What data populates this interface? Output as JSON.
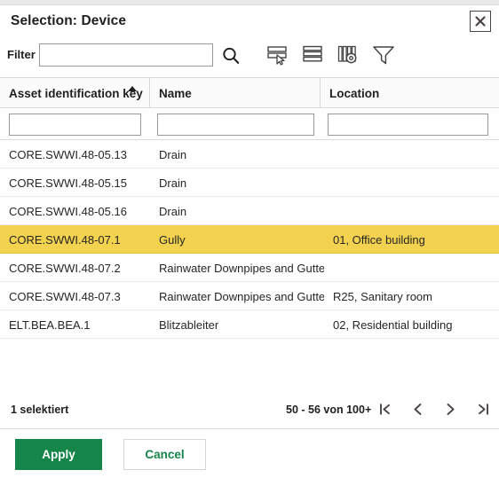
{
  "dialog": {
    "title": "Selection: Device",
    "close_label": "×"
  },
  "filter": {
    "label": "Filter",
    "value": "",
    "placeholder": "",
    "search_icon": "search-icon"
  },
  "toolbar": {
    "icons": [
      {
        "name": "select-rows-icon",
        "title": "Select rows"
      },
      {
        "name": "rows-icon",
        "title": "Rows"
      },
      {
        "name": "columns-settings-icon",
        "title": "Column settings"
      },
      {
        "name": "funnel-filter-icon",
        "title": "Filter"
      }
    ]
  },
  "table": {
    "columns": [
      {
        "label": "Asset identification key",
        "sorted": "asc",
        "filter_value": ""
      },
      {
        "label": "Name",
        "sorted": "",
        "filter_value": ""
      },
      {
        "label": "Location",
        "sorted": "",
        "filter_value": ""
      }
    ],
    "rows": [
      {
        "key": "CORE.SWWI.48-05.13",
        "name": "Drain",
        "location": "",
        "selected": false
      },
      {
        "key": "CORE.SWWI.48-05.15",
        "name": "Drain",
        "location": "",
        "selected": false
      },
      {
        "key": "CORE.SWWI.48-05.16",
        "name": "Drain",
        "location": "",
        "selected": false
      },
      {
        "key": "CORE.SWWI.48-07.1",
        "name": "Gully",
        "location": "01, Office building",
        "selected": true
      },
      {
        "key": "CORE.SWWI.48-07.2",
        "name": "Rainwater Downpipes and Gutters",
        "location": "",
        "selected": false
      },
      {
        "key": "CORE.SWWI.48-07.3",
        "name": "Rainwater Downpipes and Gutters",
        "location": "R25, Sanitary room",
        "selected": false
      },
      {
        "key": "ELT.BEA.BEA.1",
        "name": "Blitzableiter",
        "location": "02, Residential building",
        "selected": false
      }
    ]
  },
  "status": {
    "selected_count": "1 selektiert",
    "page_range": "50 - 56 von 100+",
    "pager": [
      {
        "name": "first-page-icon",
        "glyph": "|<"
      },
      {
        "name": "previous-page-icon",
        "glyph": "<"
      },
      {
        "name": "next-page-icon",
        "glyph": ">"
      },
      {
        "name": "last-page-icon",
        "glyph": ">|"
      }
    ]
  },
  "footer": {
    "apply_label": "Apply",
    "cancel_label": "Cancel"
  },
  "colors": {
    "accent_green": "#16854a",
    "selected_row": "#f2d24e",
    "border": "#d9d9d9",
    "text": "#1f1f1f"
  }
}
